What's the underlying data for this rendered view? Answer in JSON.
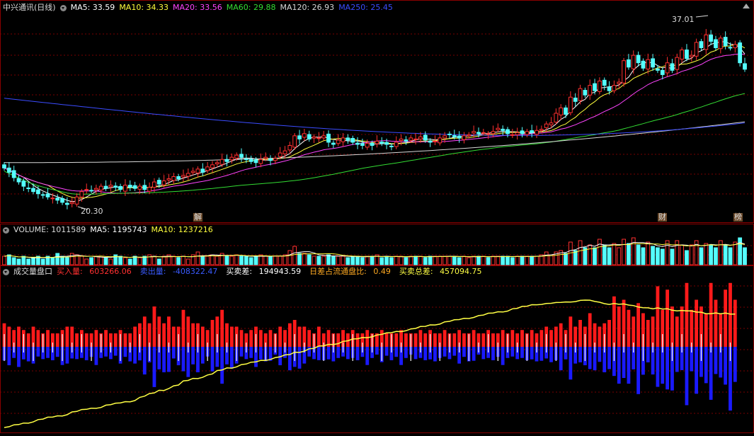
{
  "panel_main": {
    "title": "中兴通讯(日线)",
    "ma": [
      {
        "label": "MA5: 33.59",
        "color": "#ffffff"
      },
      {
        "label": "MA10: 34.33",
        "color": "#ffff3c"
      },
      {
        "label": "MA20: 33.56",
        "color": "#ff44ff"
      },
      {
        "label": "MA60: 29.88",
        "color": "#33dd33"
      },
      {
        "label": "MA120: 26.93",
        "color": "#d8d8d8"
      },
      {
        "label": "MA250: 25.45",
        "color": "#3b4cff"
      }
    ],
    "high_label": "37.01",
    "low_label": "20.30",
    "markers": [
      "解",
      "财",
      "榜"
    ]
  },
  "panel_volume": {
    "title": "VOLUME: 1011589",
    "ma5": "MA5: 1195743",
    "ma10": "MA10: 1237216"
  },
  "panel_flow": {
    "title": "成交量盘口",
    "items": [
      {
        "label": "买入量:",
        "value": "603266.06",
        "color": "#ff3030"
      },
      {
        "label": "卖出量:",
        "value": "-408322.47",
        "color": "#3a5bff"
      },
      {
        "label": "买卖差:",
        "value": "194943.59",
        "color": "#ffffff"
      },
      {
        "label": "日差占流通盘比:",
        "value": "0.49",
        "color": "#ffaa22"
      },
      {
        "label": "买卖总差:",
        "value": "457094.75",
        "color": "#ffff44"
      }
    ]
  },
  "colors": {
    "up": "#ff3030",
    "down": "#54ffff",
    "buy": "#ff1a1a",
    "sell": "#1a1aff",
    "grid": "#7a0000"
  },
  "chart_data": [
    {
      "type": "candlestick",
      "price_range": [
        19.8,
        38.0
      ],
      "close": [
        23.8,
        23.4,
        22.9,
        22.5,
        22.1,
        21.9,
        21.6,
        21.4,
        21.3,
        21.1,
        21.0,
        20.8,
        20.6,
        20.4,
        20.6,
        21.1,
        21.6,
        21.8,
        21.7,
        21.9,
        22.1,
        21.9,
        22.2,
        22.0,
        21.8,
        22.2,
        22.0,
        21.9,
        22.1,
        21.8,
        22.0,
        22.5,
        22.3,
        22.6,
        22.8,
        23.0,
        22.8,
        23.1,
        23.3,
        23.5,
        23.7,
        23.4,
        23.9,
        24.1,
        24.3,
        24.6,
        24.4,
        24.8,
        25.0,
        24.8,
        24.6,
        24.4,
        24.3,
        24.6,
        24.8,
        24.5,
        24.7,
        25.2,
        25.4,
        25.9,
        26.8,
        26.5,
        27.0,
        26.5,
        26.7,
        26.6,
        26.8,
        26.2,
        26.0,
        26.4,
        26.6,
        26.4,
        26.2,
        26.0,
        25.9,
        26.1,
        25.9,
        26.3,
        26.1,
        26.0,
        25.8,
        26.2,
        26.5,
        26.3,
        26.6,
        26.5,
        26.7,
        26.4,
        26.2,
        26.3,
        26.6,
        26.8,
        26.9,
        26.7,
        26.6,
        26.8,
        26.9,
        27.2,
        27.0,
        27.1,
        27.0,
        27.2,
        27.5,
        27.3,
        27.0,
        26.9,
        27.1,
        27.0,
        27.2,
        27.1,
        27.3,
        27.4,
        27.9,
        28.0,
        28.9,
        29.4,
        28.8,
        30.4,
        30.0,
        31.2,
        30.6,
        31.5,
        31.0,
        31.9,
        31.5,
        31.0,
        31.5,
        31.8,
        33.8,
        33.2,
        34.3,
        33.6,
        33.1,
        33.9,
        33.2,
        32.9,
        32.5,
        33.6,
        32.9,
        34.1,
        34.8,
        34.0,
        34.3,
        35.5,
        35.0,
        36.2,
        35.6,
        35.0,
        35.9,
        35.2,
        35.0,
        35.3,
        33.6,
        33.0
      ]
    },
    {
      "type": "bar",
      "name": "VOLUME",
      "values": [
        0.3,
        0.35,
        0.25,
        0.2,
        0.3,
        0.2,
        0.25,
        0.3,
        0.2,
        0.3,
        0.25,
        0.4,
        0.3,
        0.25,
        0.4,
        0.35,
        0.3,
        0.2,
        0.25,
        0.3,
        0.3,
        0.25,
        0.2,
        0.35,
        0.3,
        0.25,
        0.2,
        0.3,
        0.25,
        0.3,
        0.35,
        0.3,
        0.2,
        0.3,
        0.35,
        0.3,
        0.25,
        0.3,
        0.2,
        0.35,
        0.45,
        0.3,
        0.3,
        0.35,
        0.3,
        0.4,
        0.3,
        0.3,
        0.35,
        0.3,
        0.3,
        0.25,
        0.3,
        0.35,
        0.3,
        0.3,
        0.3,
        0.3,
        0.35,
        0.5,
        0.65,
        0.4,
        0.4,
        0.35,
        0.3,
        0.3,
        0.3,
        0.35,
        0.3,
        0.3,
        0.3,
        0.25,
        0.3,
        0.3,
        0.25,
        0.3,
        0.3,
        0.35,
        0.25,
        0.3,
        0.25,
        0.3,
        0.3,
        0.25,
        0.3,
        0.3,
        0.3,
        0.25,
        0.3,
        0.3,
        0.3,
        0.3,
        0.3,
        0.3,
        0.25,
        0.3,
        0.25,
        0.3,
        0.3,
        0.3,
        0.25,
        0.3,
        0.3,
        0.3,
        0.3,
        0.25,
        0.3,
        0.3,
        0.3,
        0.3,
        0.3,
        0.35,
        0.45,
        0.35,
        0.45,
        0.5,
        0.4,
        0.8,
        0.5,
        0.85,
        0.6,
        0.7,
        0.6,
        0.9,
        0.7,
        0.6,
        0.75,
        0.6,
        0.9,
        0.75,
        0.95,
        0.7,
        0.6,
        0.8,
        0.65,
        0.6,
        0.55,
        0.85,
        0.55,
        0.85,
        0.7,
        0.5,
        0.7,
        0.85,
        0.6,
        0.75,
        0.7,
        0.6,
        0.85,
        0.7,
        0.6,
        0.8,
        0.95,
        0.6
      ]
    },
    {
      "type": "bar",
      "name": "成交量盘口",
      "buy": [
        0.35,
        0.3,
        0.25,
        0.3,
        0.25,
        0.2,
        0.3,
        0.25,
        0.2,
        0.25,
        0.2,
        0.2,
        0.25,
        0.3,
        0.3,
        0.2,
        0.25,
        0.2,
        0.2,
        0.25,
        0.2,
        0.25,
        0.2,
        0.2,
        0.25,
        0.2,
        0.2,
        0.3,
        0.35,
        0.45,
        0.35,
        0.6,
        0.45,
        0.35,
        0.45,
        0.3,
        0.3,
        0.55,
        0.45,
        0.35,
        0.35,
        0.3,
        0.25,
        0.4,
        0.45,
        0.55,
        0.35,
        0.3,
        0.3,
        0.25,
        0.2,
        0.25,
        0.3,
        0.25,
        0.2,
        0.25,
        0.2,
        0.3,
        0.25,
        0.35,
        0.4,
        0.3,
        0.3,
        0.25,
        0.2,
        0.3,
        0.2,
        0.25,
        0.2,
        0.2,
        0.25,
        0.2,
        0.25,
        0.2,
        0.2,
        0.25,
        0.2,
        0.2,
        0.25,
        0.2,
        0.2,
        0.2,
        0.25,
        0.2,
        0.2,
        0.2,
        0.25,
        0.2,
        0.25,
        0.2,
        0.2,
        0.25,
        0.2,
        0.2,
        0.25,
        0.2,
        0.2,
        0.25,
        0.2,
        0.2,
        0.25,
        0.2,
        0.2,
        0.25,
        0.2,
        0.25,
        0.2,
        0.25,
        0.2,
        0.25,
        0.2,
        0.25,
        0.3,
        0.25,
        0.3,
        0.35,
        0.25,
        0.45,
        0.3,
        0.4,
        0.3,
        0.5,
        0.35,
        0.3,
        0.35,
        0.4,
        0.75,
        0.6,
        0.7,
        0.55,
        0.45,
        0.65,
        0.5,
        0.4,
        0.45,
        0.9,
        0.55,
        0.85,
        0.6,
        0.45,
        0.6,
        0.95,
        0.55,
        0.7,
        0.6,
        0.5,
        0.95,
        0.7,
        0.5,
        0.85,
        0.95,
        0.7
      ]
    }
  ]
}
